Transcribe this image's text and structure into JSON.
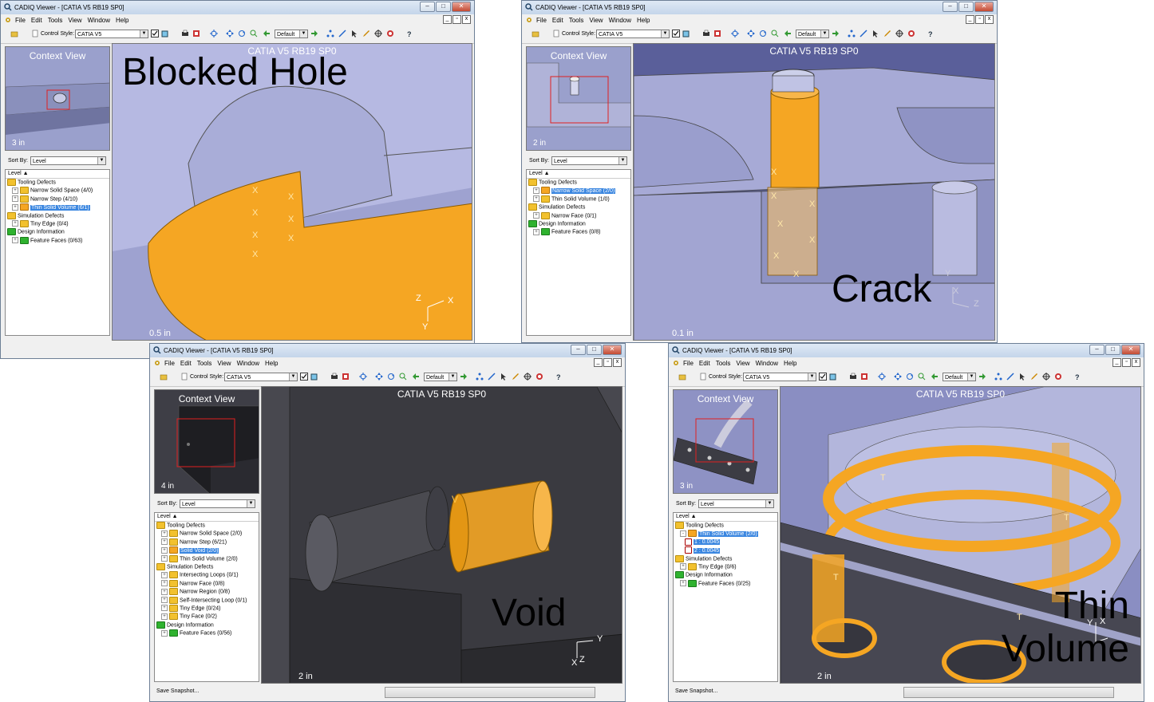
{
  "windows": [
    {
      "title": "CADIQ Viewer - [CATIA V5 RB19 SP0]",
      "menu": [
        "File",
        "Edit",
        "Tools",
        "View",
        "Window",
        "Help"
      ],
      "control_style_label": "Control Style:",
      "control_style_value": "CATIA V5",
      "view_combo": "Default",
      "context_title": "Context View",
      "context_scale": "3 in",
      "sort_label": "Sort By:",
      "sort_value": "Level",
      "tree_header": "Level",
      "tree": [
        {
          "label": "Tooling Defects",
          "folder": "y",
          "level": 0,
          "pm": ""
        },
        {
          "label": "Narrow Solid Space (4/0)",
          "folder": "y",
          "level": 1,
          "pm": "+"
        },
        {
          "label": "Narrow Step (4/10)",
          "folder": "y",
          "level": 1,
          "pm": "+"
        },
        {
          "label": "Thin Solid Volume (6/1)",
          "folder": "o",
          "level": 1,
          "pm": "+",
          "selected": true
        },
        {
          "label": "Simulation Defects",
          "folder": "y",
          "level": 0,
          "pm": ""
        },
        {
          "label": "Tiny Edge (0/4)",
          "folder": "y",
          "level": 1,
          "pm": "+"
        },
        {
          "label": "Design Information",
          "folder": "g",
          "level": 0,
          "pm": ""
        },
        {
          "label": "Feature Faces (0/63)",
          "folder": "g",
          "level": 1,
          "pm": "+"
        }
      ],
      "viewport_title": "CATIA V5 RB19 SP0",
      "viewport_scale": "0.5 in",
      "axis": [
        "Z",
        "X",
        "Y"
      ],
      "defect_marker": "X",
      "caption": "Blocked Hole"
    },
    {
      "title": "CADIQ Viewer - [CATIA V5 RB19 SP0]",
      "menu": [
        "File",
        "Edit",
        "Tools",
        "View",
        "Window",
        "Help"
      ],
      "control_style_label": "Control Style:",
      "control_style_value": "CATIA V5",
      "view_combo": "Default",
      "context_title": "Context View",
      "context_scale": "2 in",
      "sort_label": "Sort By:",
      "sort_value": "Level",
      "tree_header": "Level",
      "tree": [
        {
          "label": "Tooling Defects",
          "folder": "y",
          "level": 0,
          "pm": ""
        },
        {
          "label": "Narrow Solid Space (2/0)",
          "folder": "o",
          "level": 1,
          "pm": "+",
          "selected": true
        },
        {
          "label": "Thin Solid Volume (1/0)",
          "folder": "y",
          "level": 1,
          "pm": "+"
        },
        {
          "label": "Simulation Defects",
          "folder": "y",
          "level": 0,
          "pm": ""
        },
        {
          "label": "Narrow Face (0/1)",
          "folder": "y",
          "level": 1,
          "pm": "+"
        },
        {
          "label": "Design Information",
          "folder": "g",
          "level": 0,
          "pm": ""
        },
        {
          "label": "Feature Faces (0/8)",
          "folder": "g",
          "level": 1,
          "pm": "+"
        }
      ],
      "viewport_title": "CATIA V5 RB19 SP0",
      "viewport_scale": "0.1 in",
      "axis": [
        "Y",
        "X",
        "Z"
      ],
      "defect_marker": "X",
      "caption": "Crack"
    },
    {
      "title": "CADIQ Viewer - [CATIA V5 RB19 SP0]",
      "menu": [
        "File",
        "Edit",
        "Tools",
        "View",
        "Window",
        "Help"
      ],
      "control_style_label": "Control Style:",
      "control_style_value": "CATIA V5",
      "view_combo": "Default",
      "context_title": "Context View",
      "context_scale": "4 in",
      "sort_label": "Sort By:",
      "sort_value": "Level",
      "tree_header": "Level",
      "tree": [
        {
          "label": "Tooling Defects",
          "folder": "y",
          "level": 0,
          "pm": ""
        },
        {
          "label": "Narrow Solid Space (2/0)",
          "folder": "y",
          "level": 1,
          "pm": "+"
        },
        {
          "label": "Narrow Step (6/21)",
          "folder": "y",
          "level": 1,
          "pm": "+"
        },
        {
          "label": "Solid Void (2/0)",
          "folder": "o",
          "level": 1,
          "pm": "+",
          "selected": true
        },
        {
          "label": "Thin Solid Volume (2/0)",
          "folder": "y",
          "level": 1,
          "pm": "+"
        },
        {
          "label": "Simulation Defects",
          "folder": "y",
          "level": 0,
          "pm": ""
        },
        {
          "label": "Intersecting Loops (0/1)",
          "folder": "y",
          "level": 1,
          "pm": "+"
        },
        {
          "label": "Narrow Face (0/8)",
          "folder": "y",
          "level": 1,
          "pm": "+"
        },
        {
          "label": "Narrow Region (0/8)",
          "folder": "y",
          "level": 1,
          "pm": "+"
        },
        {
          "label": "Self-Intersecting Loop (0/1)",
          "folder": "y",
          "level": 1,
          "pm": "+"
        },
        {
          "label": "Tiny Edge (0/24)",
          "folder": "y",
          "level": 1,
          "pm": "+"
        },
        {
          "label": "Tiny Face (0/2)",
          "folder": "y",
          "level": 1,
          "pm": "+"
        },
        {
          "label": "Design Information",
          "folder": "g",
          "level": 0,
          "pm": ""
        },
        {
          "label": "Feature Faces (0/56)",
          "folder": "g",
          "level": 1,
          "pm": "+"
        }
      ],
      "viewport_title": "CATIA V5 RB19 SP0",
      "viewport_scale": "2 in",
      "axis": [
        "Y",
        "X",
        "Z"
      ],
      "defect_marker": "V",
      "status": "Save Snapshot...",
      "caption": "Void"
    },
    {
      "title": "CADIQ Viewer - [CATIA V5 RB19 SP0]",
      "menu": [
        "File",
        "Edit",
        "Tools",
        "View",
        "Window",
        "Help"
      ],
      "control_style_label": "Control Style:",
      "control_style_value": "CATIA V5",
      "view_combo": "Default",
      "context_title": "Context View",
      "context_scale": "3 in",
      "sort_label": "Sort By:",
      "sort_value": "Level",
      "tree_header": "Level",
      "tree": [
        {
          "label": "Tooling Defects",
          "folder": "y",
          "level": 0,
          "pm": ""
        },
        {
          "label": "Thin Solid Volume (2/0)",
          "folder": "o",
          "level": 1,
          "pm": "-",
          "selected": true
        },
        {
          "label": "1 : 0.0045",
          "folder": "box",
          "level": 2,
          "pm": "",
          "selected": true
        },
        {
          "label": "2 : 0.0045",
          "folder": "box",
          "level": 2,
          "pm": "",
          "selected": true
        },
        {
          "label": "Simulation Defects",
          "folder": "y",
          "level": 0,
          "pm": ""
        },
        {
          "label": "Tiny Edge (0/6)",
          "folder": "y",
          "level": 1,
          "pm": "+"
        },
        {
          "label": "Design Information",
          "folder": "g",
          "level": 0,
          "pm": ""
        },
        {
          "label": "Feature Faces (0/25)",
          "folder": "g",
          "level": 1,
          "pm": "+"
        }
      ],
      "viewport_title": "CATIA V5 RB19 SP0",
      "viewport_scale": "2 in",
      "axis": [
        "Y",
        "X"
      ],
      "defect_marker": "T",
      "status": "Save Snapshot...",
      "caption_line1": "Thin",
      "caption_line2": "Volume"
    }
  ],
  "colors": {
    "defect_orange": "#f5a623",
    "selection_blue": "#3a86e0",
    "viewport_blue": "#aab0dc",
    "viewport_dark": "#4a4a52"
  }
}
